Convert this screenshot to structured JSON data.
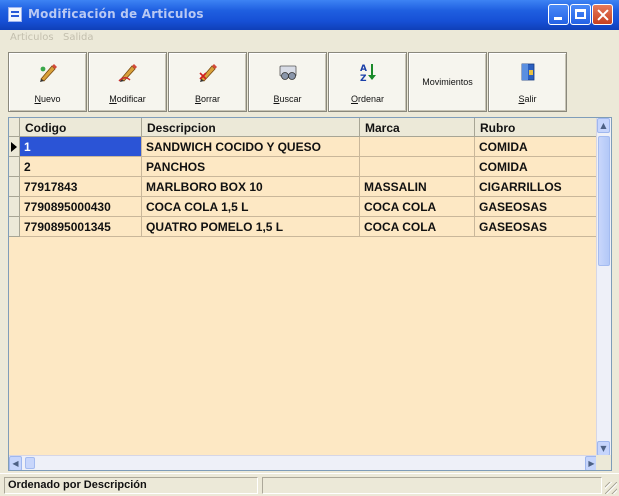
{
  "window": {
    "title": "Modificación de Articulos"
  },
  "menu": {
    "items": [
      "Articulos",
      "Salida"
    ]
  },
  "toolbar": {
    "buttons": [
      {
        "pre": "",
        "ul": "N",
        "post": "uevo",
        "icon": "pencil-icon"
      },
      {
        "pre": "",
        "ul": "M",
        "post": "odificar",
        "icon": "pencil-icon"
      },
      {
        "pre": "",
        "ul": "B",
        "post": "orrar",
        "icon": "pencil-icon"
      },
      {
        "pre": "",
        "ul": "B",
        "post": "uscar",
        "icon": "binoculars-icon"
      },
      {
        "pre": "",
        "ul": "O",
        "post": "rdenar",
        "icon": "sort-az-icon"
      },
      {
        "pre": "Movimientos",
        "ul": "",
        "post": "",
        "icon": ""
      },
      {
        "pre": "",
        "ul": "S",
        "post": "alir",
        "icon": "exit-door-icon"
      }
    ]
  },
  "grid": {
    "columns": [
      "Codigo",
      "Descripcion",
      "Marca",
      "Rubro"
    ],
    "rows": [
      [
        "1",
        "SANDWICH COCIDO Y QUESO",
        "",
        "COMIDA"
      ],
      [
        "2",
        "PANCHOS",
        "",
        "COMIDA"
      ],
      [
        "77917843",
        "MARLBORO BOX 10",
        "MASSALIN",
        "CIGARRILLOS"
      ],
      [
        "7790895000430",
        "COCA COLA 1,5 L",
        "COCA COLA",
        "GASEOSAS"
      ],
      [
        "7790895001345",
        "QUATRO POMELO 1,5 L",
        "COCA COLA",
        "GASEOSAS"
      ]
    ],
    "selected_row": 0
  },
  "status": {
    "text": "Ordenado por Descripción"
  },
  "colors": {
    "title_bar": "#1f5fe0",
    "grid_bg": "#fde8c4",
    "selection": "#2b54d6"
  }
}
